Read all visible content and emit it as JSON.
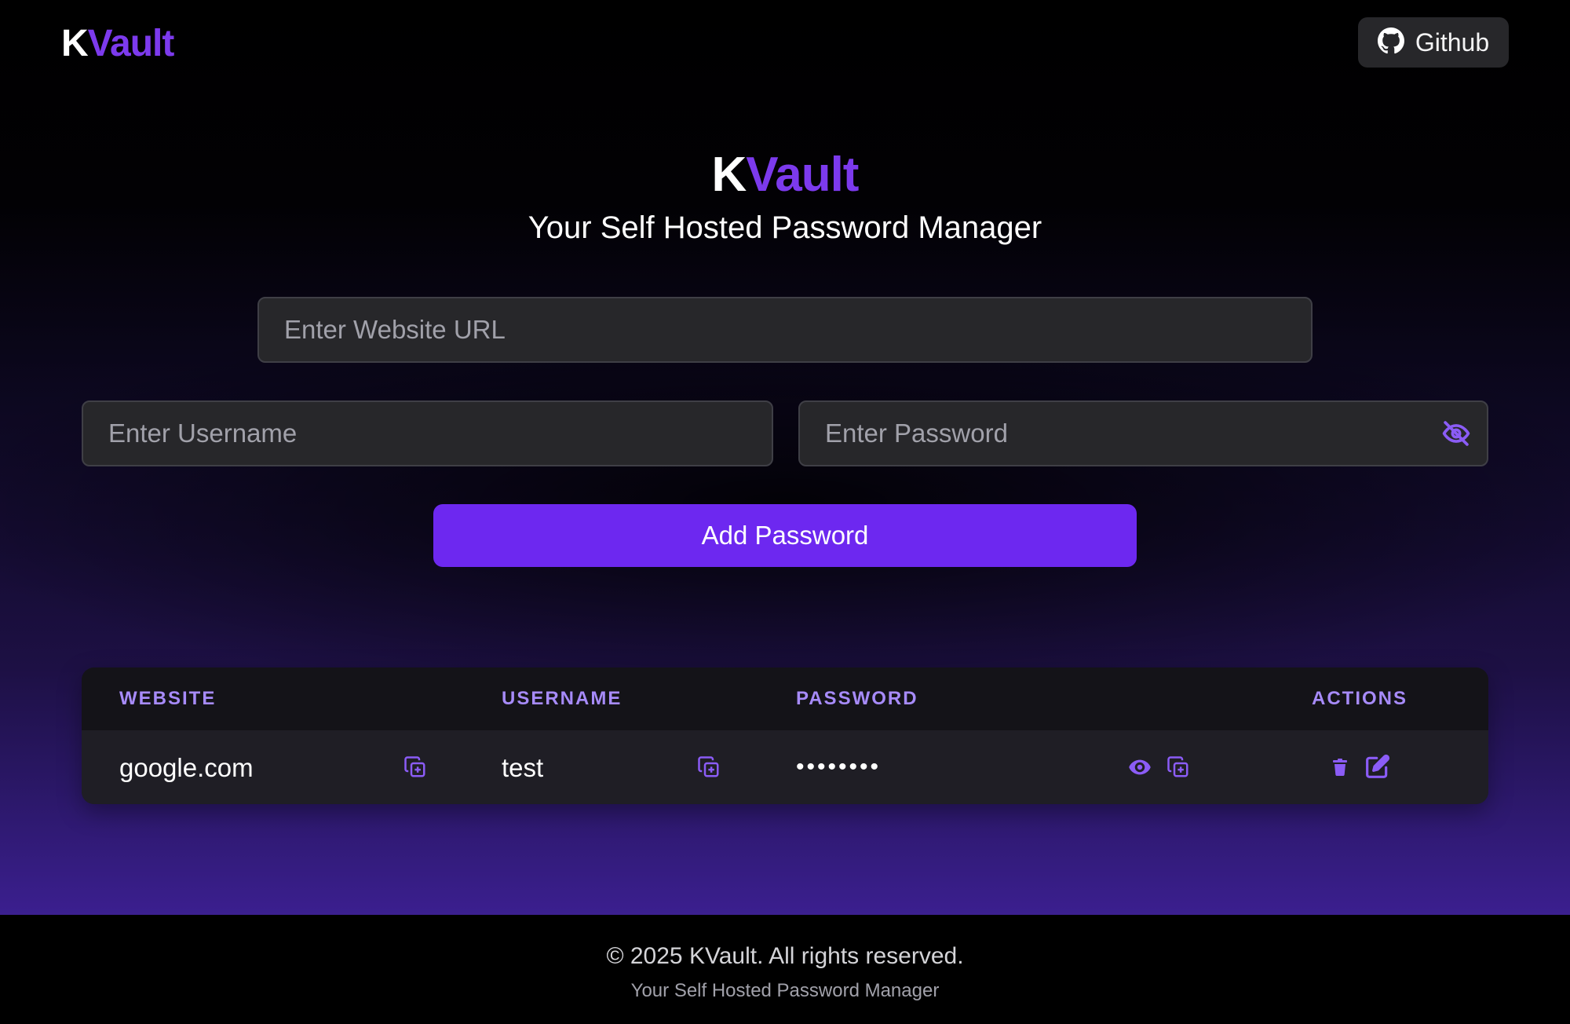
{
  "theme": {
    "accent": "#7c3aed",
    "button": "#6d28f0",
    "header_text": "#a78bfa",
    "icon": "#8b5cf6"
  },
  "navbar": {
    "logo_k": "K",
    "logo_vault": "Vault",
    "github_label": "Github",
    "github_icon": "github-icon"
  },
  "hero": {
    "title_k": "K",
    "title_vault": "Vault",
    "subtitle": "Your Self Hosted Password Manager"
  },
  "form": {
    "url_placeholder": "Enter Website URL",
    "url_value": "",
    "username_placeholder": "Enter Username",
    "username_value": "",
    "password_placeholder": "Enter Password",
    "password_value": "",
    "password_toggle_icon": "eye-slash-icon",
    "submit_label": "Add Password"
  },
  "table": {
    "columns": [
      "WEBSITE",
      "USERNAME",
      "PASSWORD",
      "ACTIONS"
    ],
    "rows": [
      {
        "website": "google.com",
        "username": "test",
        "password_masked": "••••••••"
      }
    ]
  },
  "footer": {
    "copyright": "© 2025 KVault. All rights reserved.",
    "tagline": "Your Self Hosted Password Manager"
  }
}
